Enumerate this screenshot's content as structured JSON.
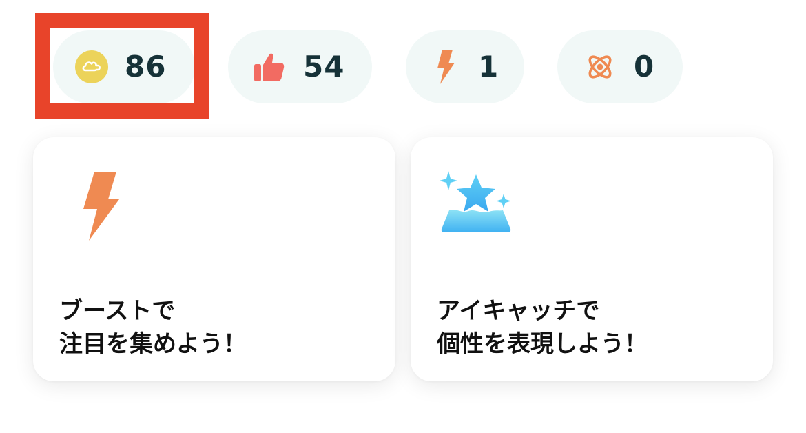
{
  "stats": [
    {
      "name": "point",
      "icon": "cloud-coin-icon",
      "count": "86",
      "color": "#ecd35a"
    },
    {
      "name": "like",
      "icon": "thumbs-up-icon",
      "count": "54",
      "color": "#f26b62"
    },
    {
      "name": "boost",
      "icon": "lightning-icon",
      "count": "1",
      "color": "#ef8a52"
    },
    {
      "name": "orbit",
      "icon": "orbit-icon",
      "count": "0",
      "color": "#ef8a52"
    }
  ],
  "highlight": {
    "target": "point",
    "color": "#e8442a"
  },
  "cards": [
    {
      "icon": "lightning-icon",
      "line1": "ブーストで",
      "line2": "注目を集めよう！"
    },
    {
      "icon": "sparkle-star-icon",
      "line1": "アイキャッチで",
      "line2": "個性を表現しよう！"
    }
  ],
  "colors": {
    "pill_bg": "#f1f8f7",
    "count_text": "#163238",
    "card_text": "#111111",
    "star_gradient": [
      "#3fb1f2",
      "#8ee3f5"
    ]
  }
}
